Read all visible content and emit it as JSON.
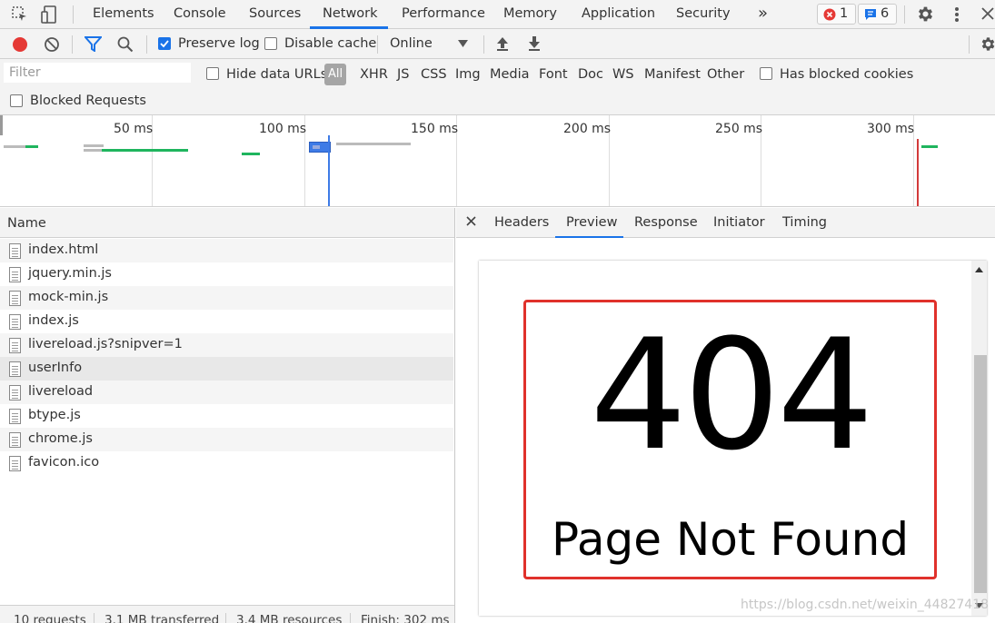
{
  "tabs": [
    {
      "label": "Elements"
    },
    {
      "label": "Console"
    },
    {
      "label": "Sources"
    },
    {
      "label": "Network"
    },
    {
      "label": "Performance"
    },
    {
      "label": "Memory"
    },
    {
      "label": "Application"
    },
    {
      "label": "Security"
    }
  ],
  "more_tabs": "»",
  "active_tab": "Network",
  "error_count": "1",
  "message_count": "6",
  "toolbar": {
    "preserve_log": "Preserve log",
    "preserve_log_checked": true,
    "disable_cache": "Disable cache",
    "disable_cache_checked": false,
    "throttle": "Online"
  },
  "filterbar": {
    "filter_placeholder": "Filter",
    "hide_data_urls": "Hide data URLs",
    "types": [
      "All",
      "XHR",
      "JS",
      "CSS",
      "Img",
      "Media",
      "Font",
      "Doc",
      "WS",
      "Manifest",
      "Other"
    ],
    "selected_type": "All",
    "has_blocked_cookies": "Has blocked cookies",
    "blocked_requests": "Blocked Requests"
  },
  "overview": {
    "ticks": [
      "50 ms",
      "100 ms",
      "150 ms",
      "200 ms",
      "250 ms",
      "300 ms"
    ]
  },
  "requests": {
    "column_name": "Name",
    "rows": [
      {
        "name": "index.html"
      },
      {
        "name": "jquery.min.js"
      },
      {
        "name": "mock-min.js"
      },
      {
        "name": "index.js"
      },
      {
        "name": "livereload.js?snipver=1"
      },
      {
        "name": "userInfo"
      },
      {
        "name": "livereload"
      },
      {
        "name": "btype.js"
      },
      {
        "name": "chrome.js"
      },
      {
        "name": "favicon.ico"
      }
    ],
    "selected": "userInfo",
    "status": {
      "requests": "10 requests",
      "transferred": "3.1 MB transferred",
      "resources": "3.4 MB resources",
      "finish": "Finish: 302 ms"
    }
  },
  "detail": {
    "tabs": [
      "Headers",
      "Preview",
      "Response",
      "Initiator",
      "Timing"
    ],
    "active_tab": "Preview",
    "preview": {
      "code": "404",
      "message": "Page Not Found"
    }
  },
  "watermark": "https://blog.csdn.net/weixin_44827418",
  "colors": {
    "accent": "#1a73e8",
    "record": "#e53935",
    "error_box": "#e0312b"
  }
}
